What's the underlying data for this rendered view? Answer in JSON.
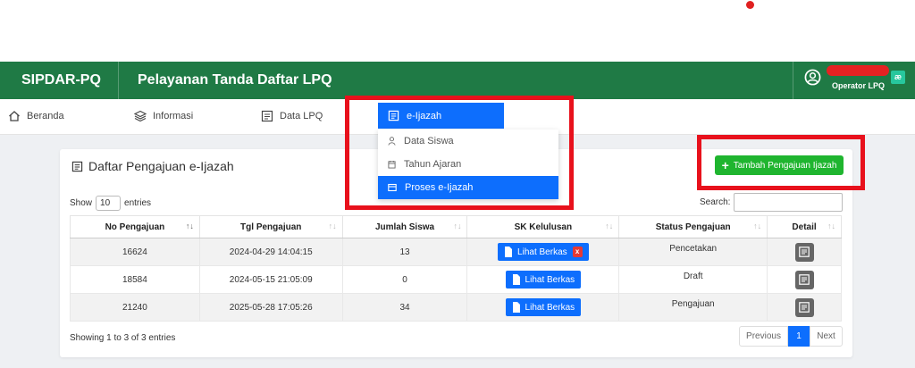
{
  "header": {
    "brand": "SIPDAR-PQ",
    "title": "Pelayanan Tanda Daftar LPQ",
    "user_role": "Operator LPQ",
    "user_badge": "æ"
  },
  "nav": {
    "items": [
      {
        "label": "Beranda",
        "icon": "home-icon"
      },
      {
        "label": "Informasi",
        "icon": "layers-icon"
      },
      {
        "label": "Data LPQ",
        "icon": "document-icon"
      }
    ]
  },
  "dropdown": {
    "head": "e-Ijazah",
    "items": [
      {
        "label": "Data Siswa",
        "icon": "user-icon"
      },
      {
        "label": "Tahun Ajaran",
        "icon": "calendar-icon"
      },
      {
        "label": "Proses e-Ijazah",
        "icon": "card-icon",
        "active": true
      }
    ]
  },
  "card": {
    "title": "Daftar Pengajuan e-Ijazah",
    "add_button": "Tambah Pengajuan Ijazah",
    "show_label": "Show",
    "entries_value": "10",
    "entries_label": "entries",
    "search_label": "Search:",
    "search_value": ""
  },
  "table": {
    "columns": [
      "No Pengajuan",
      "Tgl Pengajuan",
      "Jumlah Siswa",
      "SK Kelulusan",
      "Status Pengajuan",
      "Detail"
    ],
    "rows": [
      {
        "no": "16624",
        "tgl": "2024-04-29 14:04:15",
        "jumlah": "13",
        "sk": "Lihat Berkas",
        "x": "x",
        "status": "Pencetakan"
      },
      {
        "no": "18584",
        "tgl": "2024-05-15 21:05:09",
        "jumlah": "0",
        "sk": "Lihat Berkas",
        "status": "Draft"
      },
      {
        "no": "21240",
        "tgl": "2025-05-28 17:05:26",
        "jumlah": "34",
        "sk": "Lihat Berkas",
        "status": "Pengajuan"
      }
    ]
  },
  "footer": {
    "info": "Showing 1 to 3 of 3 entries",
    "prev": "Previous",
    "page": "1",
    "next": "Next"
  },
  "colors": {
    "header_green": "#1f7a45",
    "primary_blue": "#0d6efd",
    "add_green": "#1fb52f",
    "highlight_red": "#e8111c"
  }
}
